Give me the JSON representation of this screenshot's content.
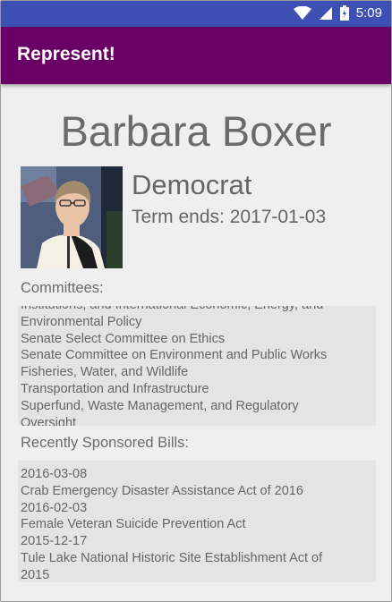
{
  "status_bar": {
    "time": "5:09",
    "icons": [
      "wifi-icon",
      "signal-icon",
      "battery-icon"
    ]
  },
  "app_bar": {
    "title": "Represent!",
    "color": "#6a0066"
  },
  "representative": {
    "name": "Barbara Boxer",
    "party": "Democrat",
    "term": "Term ends: 2017-01-03"
  },
  "committees": {
    "label": "Committees:",
    "items": [
      "Institutions, and International Economic, Energy, and",
      "Environmental Policy",
      "Senate Select Committee on Ethics",
      "Senate Committee on Environment and Public Works",
      "Fisheries, Water, and Wildlife",
      "Transportation and Infrastructure",
      "Superfund, Waste Management, and Regulatory",
      "Oversight"
    ]
  },
  "bills": {
    "label": "Recently Sponsored Bills:",
    "items": [
      "2016-03-08",
      "Crab Emergency Disaster Assistance Act of 2016",
      "2016-02-03",
      "Female Veteran Suicide Prevention Act",
      "2015-12-17",
      "Tule Lake National Historic Site Establishment Act of",
      "2015"
    ]
  }
}
